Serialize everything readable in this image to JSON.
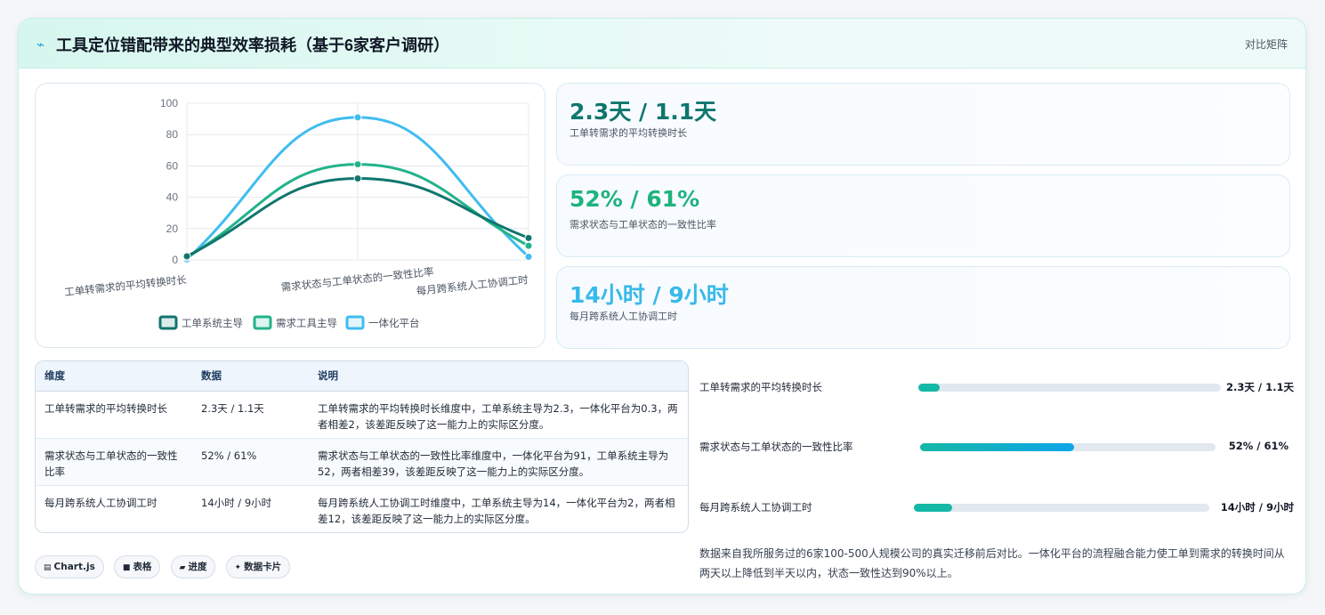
{
  "header": {
    "icon": "lightning-icon",
    "title": "工具定位错配带来的典型效率损耗（基于6家客户调研）",
    "badge": "对比矩阵"
  },
  "chart_data": {
    "type": "line",
    "categories": [
      "工单转需求的平均转换时长",
      "需求状态与工单状态的一致性比率",
      "每月跨系统人工协调工时"
    ],
    "series": [
      {
        "name": "工单系统主导",
        "values": [
          2.3,
          52,
          14
        ],
        "color": "#0f766e"
      },
      {
        "name": "需求工具主导",
        "values": [
          1.5,
          61,
          9
        ],
        "color": "#22b38a"
      },
      {
        "name": "一体化平台",
        "values": [
          0.3,
          91,
          2
        ],
        "color": "#3fbdf0"
      }
    ],
    "yticks": [
      0,
      20,
      40,
      60,
      80,
      100
    ],
    "ylim": [
      0,
      100
    ],
    "grid": true,
    "legend_position": "bottom",
    "curve": "smooth"
  },
  "stats": [
    {
      "value": "2.3天 / 1.1天",
      "label": "工单转需求的平均转换时长",
      "color": "#0f766e"
    },
    {
      "value": "52% / 61%",
      "label": "需求状态与工单状态的一致性比率",
      "color": "#1fb27e"
    },
    {
      "value": "14小时 / 9小时",
      "label": "每月跨系统人工协调工时",
      "color": "#38b9ea"
    }
  ],
  "table": {
    "headers": [
      "维度",
      "数据",
      "说明"
    ],
    "rows": [
      {
        "dim": "工单转需求的平均转换时长",
        "data": "2.3天 / 1.1天",
        "desc": "工单转需求的平均转换时长维度中，工单系统主导为2.3，一体化平台为0.3，两者相差2，该差距反映了这一能力上的实际区分度。"
      },
      {
        "dim": "需求状态与工单状态的一致性比率",
        "data": "52% / 61%",
        "desc": "需求状态与工单状态的一致性比率维度中，一体化平台为91，工单系统主导为52，两者相差39，该差距反映了这一能力上的实际区分度。"
      },
      {
        "dim": "每月跨系统人工协调工时",
        "data": "14小时 / 9小时",
        "desc": "每月跨系统人工协调工时维度中，工单系统主导为14，一体化平台为2，两者相差12，该差距反映了这一能力上的实际区分度。"
      }
    ]
  },
  "progress": [
    {
      "label": "工单转需求的平均转换时长",
      "value": "2.3天 / 1.1天",
      "fraction": 0.07,
      "color": "#14b8a6"
    },
    {
      "label": "需求状态与工单状态的一致性比率",
      "value": "52% / 61%",
      "fraction": 0.52,
      "color": "gradient"
    },
    {
      "label": "每月跨系统人工协调工时",
      "value": "14小时 / 9小时",
      "fraction": 0.13,
      "color": "#14b8a6"
    }
  ],
  "note": "数据来自我所服务过的6家100-500人规模公司的真实迁移前后对比。一体化平台的流程融合能力使工单到需求的转换时间从两天以上降低到半天以内，状态一致性达到90%以上。",
  "tags": [
    {
      "icon": "chart-icon",
      "glyph": "▤",
      "label": "Chart.js"
    },
    {
      "icon": "table-icon",
      "glyph": "■",
      "label": "表格"
    },
    {
      "icon": "progress-icon",
      "glyph": "▰",
      "label": "进度"
    },
    {
      "icon": "sparkle-icon",
      "glyph": "✦",
      "label": "数据卡片"
    }
  ]
}
